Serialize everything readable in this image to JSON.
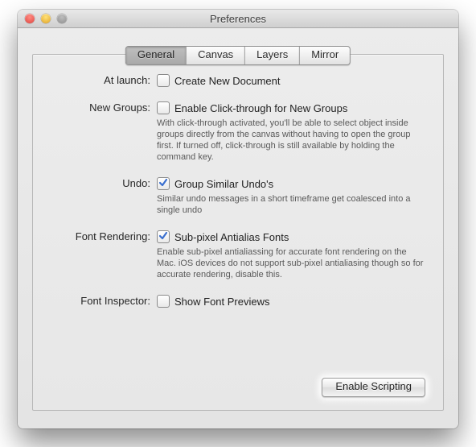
{
  "window": {
    "title": "Preferences"
  },
  "tabs": [
    {
      "label": "General",
      "active": true
    },
    {
      "label": "Canvas",
      "active": false
    },
    {
      "label": "Layers",
      "active": false
    },
    {
      "label": "Mirror",
      "active": false
    }
  ],
  "rows": {
    "at_launch": {
      "label": "At launch:",
      "checkbox_label": "Create New Document",
      "checked": false
    },
    "new_groups": {
      "label": "New Groups:",
      "checkbox_label": "Enable Click-through for New Groups",
      "checked": false,
      "description": "With click-through activated, you'll be able to select object inside groups directly from the canvas without having to open the group first. If turned off, click-through is still available by holding the command key."
    },
    "undo": {
      "label": "Undo:",
      "checkbox_label": "Group Similar Undo's",
      "checked": true,
      "description": "Similar undo messages in a short timeframe get coalesced into a single undo"
    },
    "font_rendering": {
      "label": "Font Rendering:",
      "checkbox_label": "Sub-pixel Antialias Fonts",
      "checked": true,
      "description": "Enable sub-pixel antialiassing for accurate font rendering on the Mac. iOS devices do not support sub-pixel antialiasing though so for accurate rendering, disable this."
    },
    "font_inspector": {
      "label": "Font Inspector:",
      "checkbox_label": "Show Font Previews",
      "checked": false
    }
  },
  "button": {
    "enable_scripting": "Enable Scripting"
  },
  "colors": {
    "check_blue": "#3a6fcf"
  }
}
